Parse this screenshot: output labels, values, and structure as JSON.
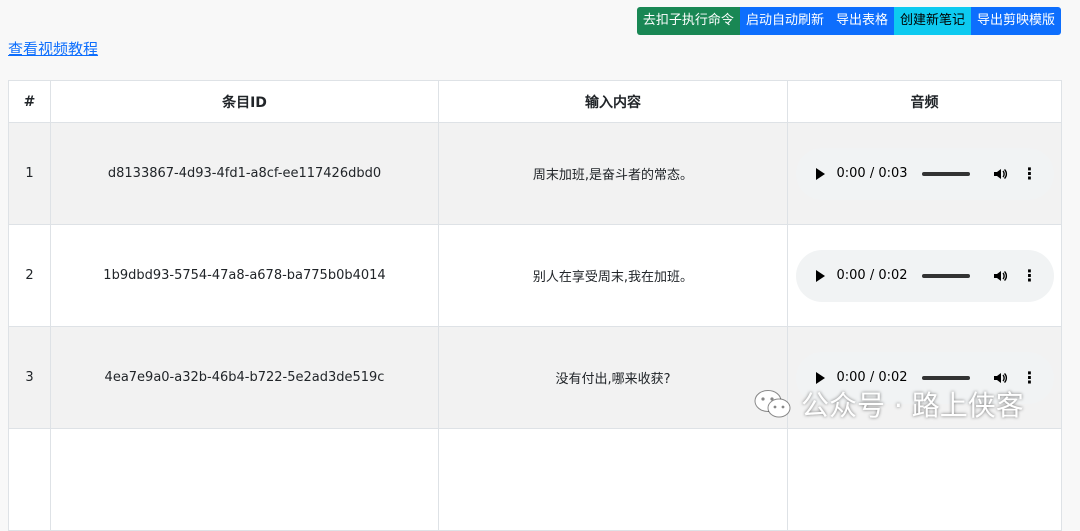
{
  "toolbar": {
    "buttons": [
      {
        "label": "去扣子执行命令",
        "color": "#198754"
      },
      {
        "label": "启动自动刷新",
        "color": "#0d6efd"
      },
      {
        "label": "导出表格",
        "color": "#0d6efd"
      },
      {
        "label": "创建新笔记",
        "color": "#0dcaf0"
      },
      {
        "label": "导出剪映模版",
        "color": "#0d6efd"
      }
    ]
  },
  "tutorial_link": "查看视频教程",
  "table": {
    "headers": [
      "#",
      "条目ID",
      "输入内容",
      "音频"
    ],
    "rows": [
      {
        "index": "1",
        "id": "d8133867-4d93-4fd1-a8cf-ee117426dbd0",
        "content": "周末加班,是奋斗者的常态。",
        "audio_time": "0:00 / 0:03"
      },
      {
        "index": "2",
        "id": "1b9dbd93-5754-47a8-a678-ba775b0b4014",
        "content": "别人在享受周末,我在加班。",
        "audio_time": "0:00 / 0:02"
      },
      {
        "index": "3",
        "id": "4ea7e9a0-a32b-46b4-b722-5e2ad3de519c",
        "content": "没有付出,哪来收获?",
        "audio_time": "0:00 / 0:02"
      }
    ]
  },
  "watermark": "公众号 · 路上侠客",
  "icons": {
    "play": "play-icon",
    "volume": "volume-icon",
    "more": "more-vert-icon",
    "watermark": "wechat-icon"
  }
}
